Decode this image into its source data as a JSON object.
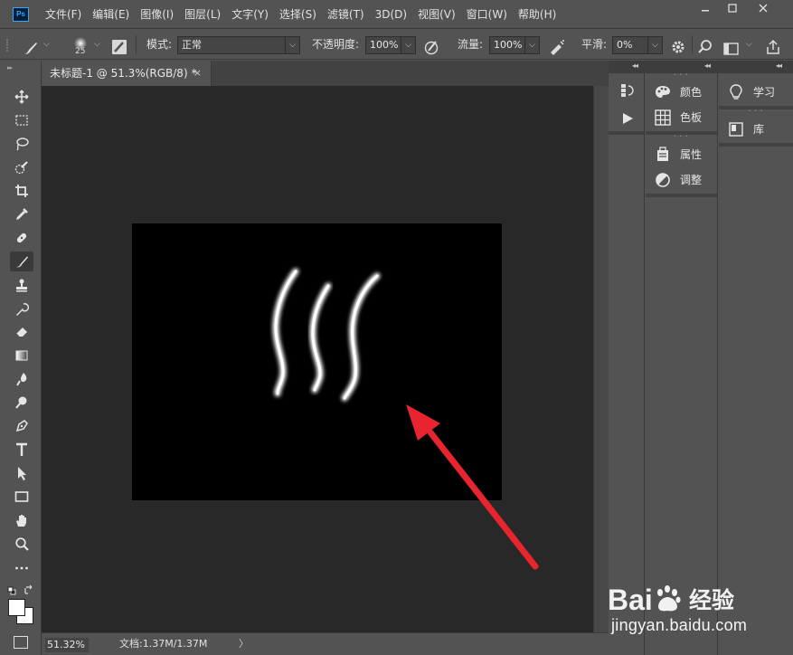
{
  "app": {
    "logo_text": "Ps",
    "menu": [
      "文件(F)",
      "编辑(E)",
      "图像(I)",
      "图层(L)",
      "文字(Y)",
      "选择(S)",
      "滤镜(T)",
      "3D(D)",
      "视图(V)",
      "窗口(W)",
      "帮助(H)"
    ],
    "window_controls": [
      "minimize-icon",
      "maximize-icon",
      "close-icon"
    ]
  },
  "options_bar": {
    "brush_size": "25",
    "mode_label": "模式:",
    "mode_value": "正常",
    "opacity_label": "不透明度:",
    "opacity_value": "100%",
    "flow_label": "流量:",
    "flow_value": "100%",
    "smoothing_label": "平滑:",
    "smoothing_value": "0%"
  },
  "toolbar": {
    "tools": [
      "move-tool",
      "marquee-tool",
      "lasso-tool",
      "quick-select-tool",
      "crop-tool",
      "eyedropper-tool",
      "healing-brush-tool",
      "brush-tool",
      "clone-stamp-tool",
      "history-brush-tool",
      "eraser-tool",
      "gradient-tool",
      "blur-tool",
      "dodge-tool",
      "pen-tool",
      "type-tool",
      "path-select-tool",
      "rectangle-tool",
      "hand-tool",
      "zoom-tool",
      "more-tools"
    ],
    "active_tool": "brush-tool",
    "foreground_color": "#ffffff",
    "background_color": "#ffffff"
  },
  "document": {
    "tab_title": "未标题-1 @ 51.3%(RGB/8) *",
    "close_glyph": "×",
    "canvas_color": "#000000",
    "stroke_color": "#ffffff",
    "annotation_arrow_color": "#e8242f"
  },
  "status": {
    "zoom": "51.32%",
    "doc_info": "文档:1.37M/1.37M",
    "arrow": "〉"
  },
  "panels": {
    "col1": [
      "history-icon",
      "play-icon"
    ],
    "col2": [
      {
        "icon": "palette-icon",
        "label": "颜色"
      },
      {
        "icon": "swatches-icon",
        "label": "色板"
      },
      {
        "icon": "properties-icon",
        "label": "属性"
      },
      {
        "icon": "adjustments-icon",
        "label": "调整"
      }
    ],
    "col3": [
      {
        "icon": "lightbulb-icon",
        "label": "学习"
      },
      {
        "icon": "library-icon",
        "label": "库"
      }
    ]
  },
  "watermark": {
    "brand": "Bai",
    "brand_cn": "经验",
    "url": "jingyan.baidu.com"
  }
}
